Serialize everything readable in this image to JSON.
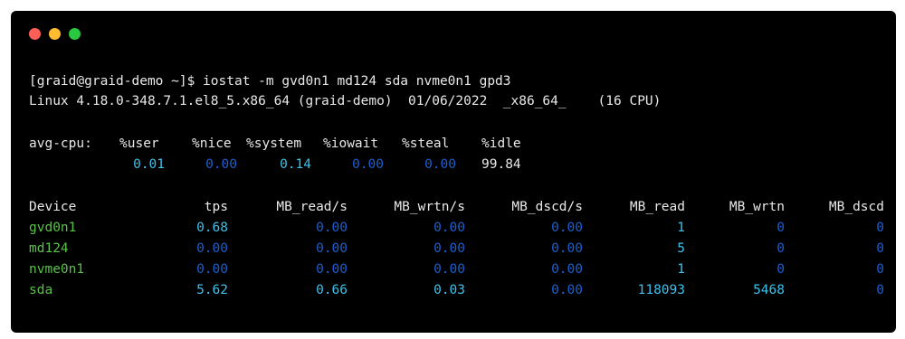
{
  "window": {
    "traffic_lights": {
      "close": "#ff5f57",
      "minimize": "#febc2e",
      "maximize": "#28c840"
    }
  },
  "terminal": {
    "prompt_line": "[graid@graid-demo ~]$ iostat -m gvd0n1 md124 sda nvme0n1 gpd3",
    "system_info": "Linux 4.18.0-348.7.1.el8_5.x86_64 (graid-demo)  01/06/2022  _x86_64_    (16 CPU)",
    "cpu": {
      "label": "avg-cpu:",
      "headers": [
        "%user",
        "%nice",
        "%system",
        "%iowait",
        "%steal",
        "%idle"
      ],
      "values": [
        "0.01",
        "0.00",
        "0.14",
        "0.00",
        "0.00",
        "99.84"
      ]
    },
    "device_table": {
      "headers": [
        "Device",
        "tps",
        "MB_read/s",
        "MB_wrtn/s",
        "MB_dscd/s",
        "MB_read",
        "MB_wrtn",
        "MB_dscd"
      ],
      "rows": [
        {
          "device": "gvd0n1",
          "tps": "0.68",
          "mb_read_s": "0.00",
          "mb_wrtn_s": "0.00",
          "mb_dscd_s": "0.00",
          "mb_read": "1",
          "mb_wrtn": "0",
          "mb_dscd": "0"
        },
        {
          "device": "md124",
          "tps": "0.00",
          "mb_read_s": "0.00",
          "mb_wrtn_s": "0.00",
          "mb_dscd_s": "0.00",
          "mb_read": "5",
          "mb_wrtn": "0",
          "mb_dscd": "0"
        },
        {
          "device": "nvme0n1",
          "tps": "0.00",
          "mb_read_s": "0.00",
          "mb_wrtn_s": "0.00",
          "mb_dscd_s": "0.00",
          "mb_read": "1",
          "mb_wrtn": "0",
          "mb_dscd": "0"
        },
        {
          "device": "sda",
          "tps": "5.62",
          "mb_read_s": "0.66",
          "mb_wrtn_s": "0.03",
          "mb_dscd_s": "0.00",
          "mb_read": "118093",
          "mb_wrtn": "5468",
          "mb_dscd": "0"
        }
      ]
    }
  },
  "colors": {
    "background": "#000000",
    "text": "#e8e8e8",
    "highlight_value": "#3ec1ea",
    "dim_value": "#1d5fd0",
    "device_name": "#5ac14a"
  }
}
